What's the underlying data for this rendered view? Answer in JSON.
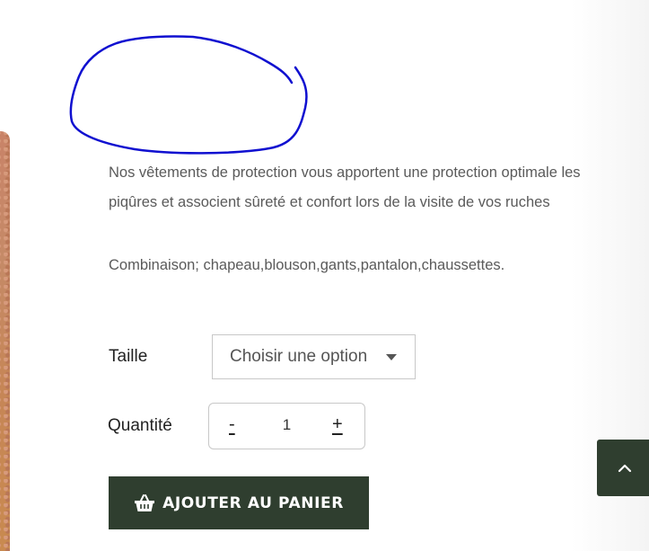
{
  "product": {
    "description": "Nos vêtements de protection vous apportent une protection optimale les piqûres et associent sûreté et confort lors de la visite de vos ruches",
    "composition": "Combinaison; chapeau,blouson,gants,pantalon,chaussettes."
  },
  "options": {
    "size_label": "Taille",
    "size_select_value": "Choisir une option"
  },
  "quantity": {
    "label": "Quantité",
    "minus": "-",
    "value": "1",
    "plus": "+"
  },
  "cart": {
    "add_label": "AJOUTER AU PANIER",
    "icon": "basket-icon"
  },
  "scroll_top": {
    "icon": "chevron-up-icon"
  },
  "colors": {
    "button_bg": "#2f3e2f",
    "scribble": "#1010d0"
  }
}
